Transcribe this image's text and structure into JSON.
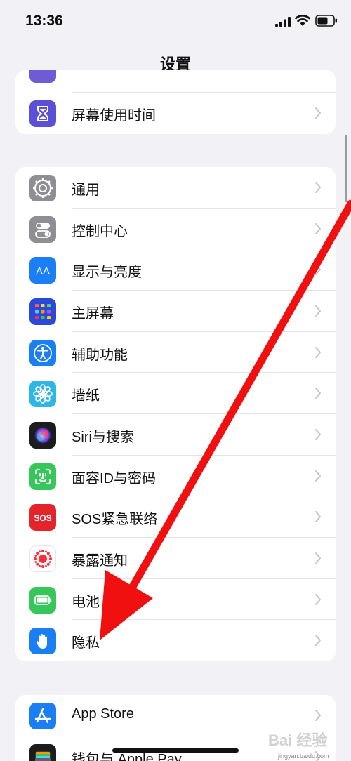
{
  "status_bar": {
    "time": "13:36"
  },
  "nav": {
    "title": "设置"
  },
  "group_a": [
    {
      "label": "屏幕使用时间",
      "icon": "hourglass-icon",
      "color": "#5b4fd6"
    }
  ],
  "group_b": [
    {
      "label": "通用",
      "icon": "gear-icon",
      "color": "#8e8e93"
    },
    {
      "label": "控制中心",
      "icon": "toggles-icon",
      "color": "#8e8e93"
    },
    {
      "label": "显示与亮度",
      "icon": "text-size-icon",
      "color": "#1a7ef5"
    },
    {
      "label": "主屏幕",
      "icon": "home-grid-icon",
      "color": "#2b49d6"
    },
    {
      "label": "辅助功能",
      "icon": "accessibility-icon",
      "color": "#1a7ef5"
    },
    {
      "label": "墙纸",
      "icon": "flower-icon",
      "color": "#2fb6e6"
    },
    {
      "label": "Siri与搜索",
      "icon": "siri-icon",
      "color": "#1c1c1e"
    },
    {
      "label": "面容ID与密码",
      "icon": "face-id-icon",
      "color": "#35c759"
    },
    {
      "label": "SOS紧急联络",
      "icon": "sos-icon",
      "color": "#e3242b"
    },
    {
      "label": "暴露通知",
      "icon": "exposure-icon",
      "color": "#ffffff"
    },
    {
      "label": "电池",
      "icon": "battery-icon",
      "color": "#35c759"
    },
    {
      "label": "隐私",
      "icon": "hand-icon",
      "color": "#1a7ef5"
    }
  ],
  "group_c": [
    {
      "label": "App Store",
      "icon": "app-store-icon",
      "color": "#1a7ef5"
    },
    {
      "label": "钱包与 Apple Pay",
      "icon": "wallet-icon",
      "color": "#1c1c1e"
    }
  ],
  "icon_sos_text": "SOS",
  "icon_aa_text": "AA",
  "watermark": {
    "logo": "Bai 经验",
    "url": "jingyan.baidu.com"
  },
  "annotation": {
    "arrow_color": "#f01010",
    "points_to": "隐私"
  }
}
